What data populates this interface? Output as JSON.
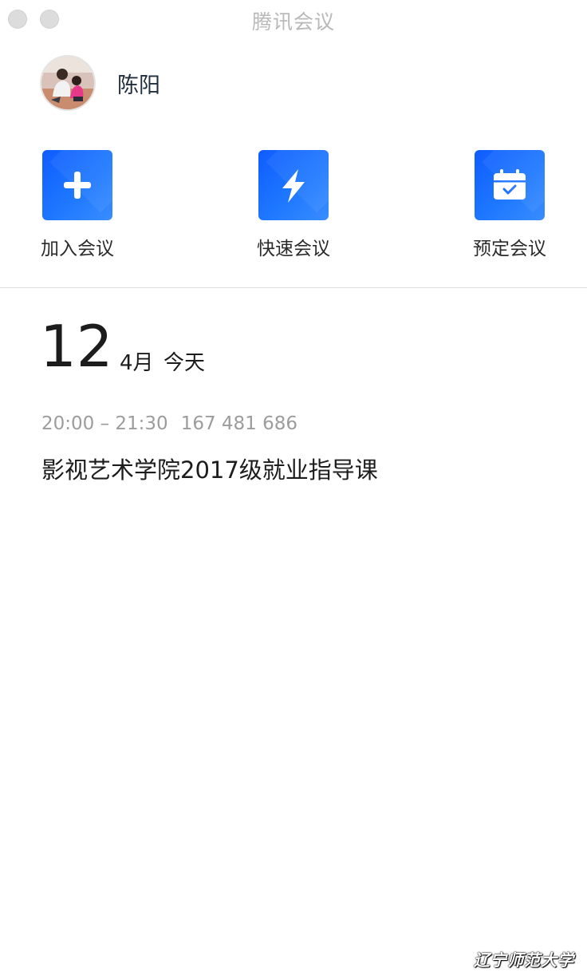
{
  "window": {
    "title": "腾讯会议"
  },
  "user": {
    "name": "陈阳"
  },
  "actions": [
    {
      "label": "加入会议",
      "icon": "plus-icon"
    },
    {
      "label": "快速会议",
      "icon": "lightning-icon"
    },
    {
      "label": "预定会议",
      "icon": "calendar-icon"
    }
  ],
  "schedule": {
    "day": "12",
    "month": "4月",
    "today_label": "今天",
    "meetings": [
      {
        "time": "20:00 – 21:30",
        "id": "167 481 686",
        "title": "影视艺术学院2017级就业指导课"
      }
    ]
  },
  "watermark": "辽宁师范大学",
  "colors": {
    "accent": "#1a6dff",
    "muted": "#9c9c9c",
    "title_bar_text": "#b9b9b9"
  }
}
